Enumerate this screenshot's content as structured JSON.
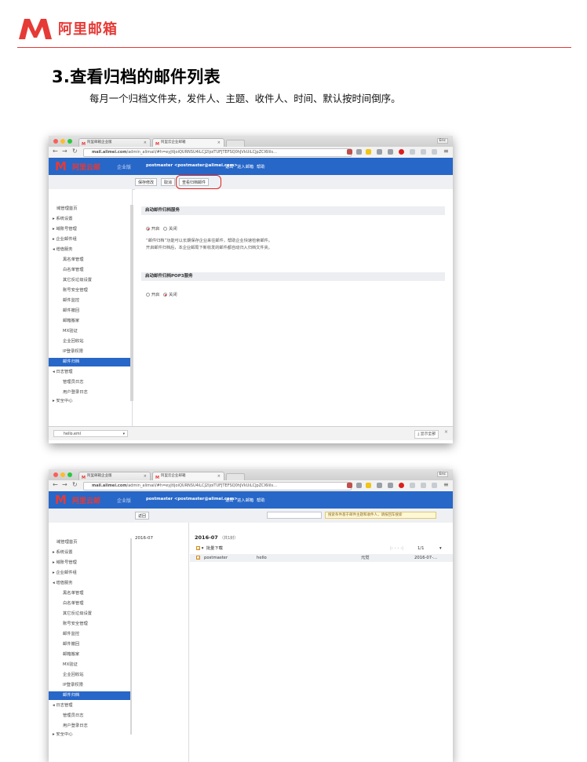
{
  "header": {
    "logo_text": "阿里邮箱",
    "brand_color": "#e63a36"
  },
  "section": {
    "title": "3.查看归档的邮件列表",
    "description": "每月一个归档文件夹，发件人、主题、收件人、时间、默认按时间倒序。"
  },
  "browser": {
    "tab1": "阿里邮箱企业版",
    "tab2": "阿里云企业邮箱",
    "user": "Eric",
    "url_host": "mail.alimei.com",
    "url_rest": "/admin_alimail/#h=eyJtIjoiQURNSU4iLCJ2IjoiTUFJTEFSQ0hJVkUiLCJpZCI6Iils...",
    "app_logo_text": "阿里云邮",
    "app_ent": "企业版",
    "app_user": "postmaster <postmaster@alimei.com>",
    "link_logout": "退出",
    "link_enter_mail": "进入邮箱",
    "link_help": "帮助"
  },
  "sidebar": {
    "items": [
      "域管理首页",
      "系统设置",
      "域账号管理",
      "企业邮件组",
      "增值服务",
      "黑名单管理",
      "白名单管理",
      "其它反垃圾设置",
      "账号安全管理",
      "邮件监控",
      "邮件撤回",
      "邮箱搬家",
      "MX验证",
      "企业回收站",
      "IP登录权限",
      "邮件归档",
      "日志管理",
      "管理员日志",
      "用户登录日志",
      "安全中心"
    ],
    "selected": "邮件归档"
  },
  "shot1": {
    "toolbar": {
      "save": "保存修改",
      "cancel": "取消",
      "view_archive": "查看归档邮件"
    },
    "archive_section": {
      "title": "启动邮件归档服务",
      "option_on": "开启",
      "option_off": "关闭",
      "desc_line1": "“邮件归档”功能可以长期保存企业来往邮件，帮助企业快速检索邮件。",
      "desc_line2": "开启邮件归档后，本企业邮局下新收发的邮件都自动归入归档文件夹。"
    },
    "pop3_section": {
      "title": "启动邮件归档POP3服务",
      "option_on": "开启",
      "option_off": "关闭"
    },
    "download": {
      "file": "hello.eml",
      "show_all": "显示全部"
    }
  },
  "shot2": {
    "toolbar": {
      "back": "返回",
      "search_hint": "搜索条件基于邮件主题和收件人，请按回车搜索"
    },
    "folder": "2016-07",
    "list_title": "2016-07",
    "list_count": "（共1封）",
    "bulk_download": "批量下载",
    "pager": "1/1",
    "rows": [
      {
        "sender": "postmaster",
        "subject": "hello",
        "recipient": "元觉",
        "time": "2016-07-..."
      }
    ]
  }
}
